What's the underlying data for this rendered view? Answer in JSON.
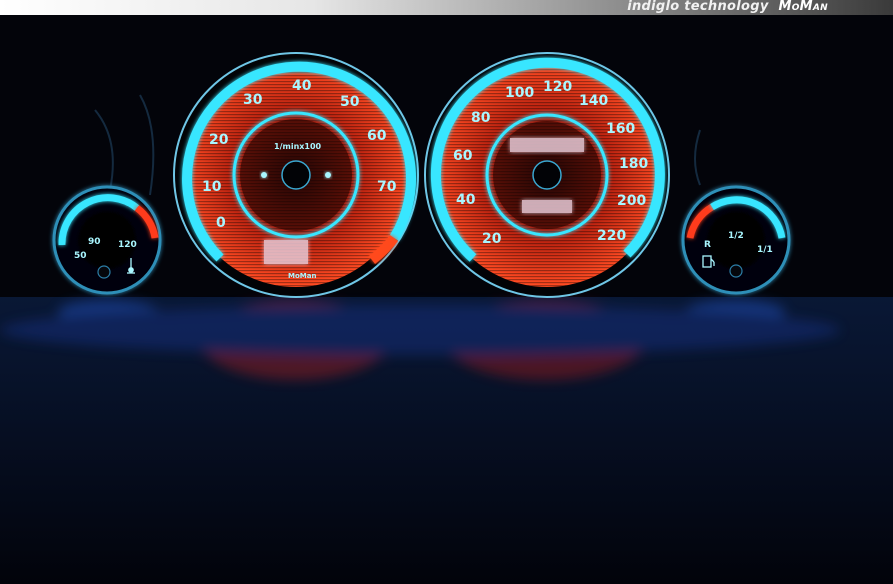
{
  "banner": {
    "tech_text": "indiglo technology",
    "logo_text": "MoMan"
  },
  "colors": {
    "indiglo": "#38e6ff",
    "indiglo_text": "#a9f6ff",
    "red_zone": "#ff3b1a",
    "background": "#03040a"
  },
  "tachometer": {
    "unit": "1/minx100",
    "labels": [
      "0",
      "10",
      "20",
      "30",
      "40",
      "50",
      "60",
      "70"
    ],
    "maker_mark": "MoMan"
  },
  "speedometer": {
    "labels": [
      "20",
      "40",
      "60",
      "80",
      "100",
      "120",
      "140",
      "160",
      "180",
      "200",
      "220"
    ]
  },
  "temperature_gauge": {
    "labels": [
      "50",
      "90",
      "120"
    ],
    "icon": "thermometer-icon"
  },
  "fuel_gauge": {
    "labels": [
      "R",
      "1/2",
      "1/1"
    ],
    "icon": "fuel-pump-icon"
  }
}
